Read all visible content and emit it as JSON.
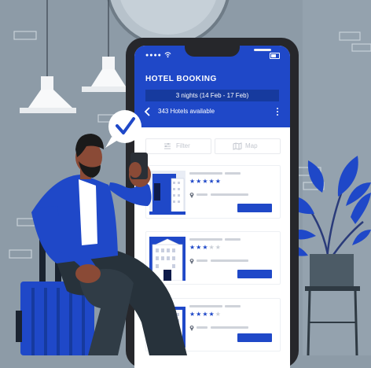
{
  "app": {
    "title": "HOTEL BOOKING",
    "dates": "3 nights (14 Feb - 17 Feb)",
    "hotels_count": "343 Hotels available",
    "status_dots": "●●●●"
  },
  "toolbar": {
    "filter_label": "Filter",
    "map_label": "Map"
  },
  "hotel_cards": [
    {
      "rating": 5
    },
    {
      "rating": 3
    },
    {
      "rating": 4
    }
  ],
  "colors": {
    "brand_blue": "#1f48c8",
    "background": "#8d9ba7",
    "phone_frame": "#26272b"
  },
  "icons": [
    "wifi-icon",
    "battery-icon",
    "back-arrow-icon",
    "more-vertical-icon",
    "filter-icon",
    "map-icon",
    "star-icon",
    "location-pin-icon",
    "checkmark-icon"
  ]
}
